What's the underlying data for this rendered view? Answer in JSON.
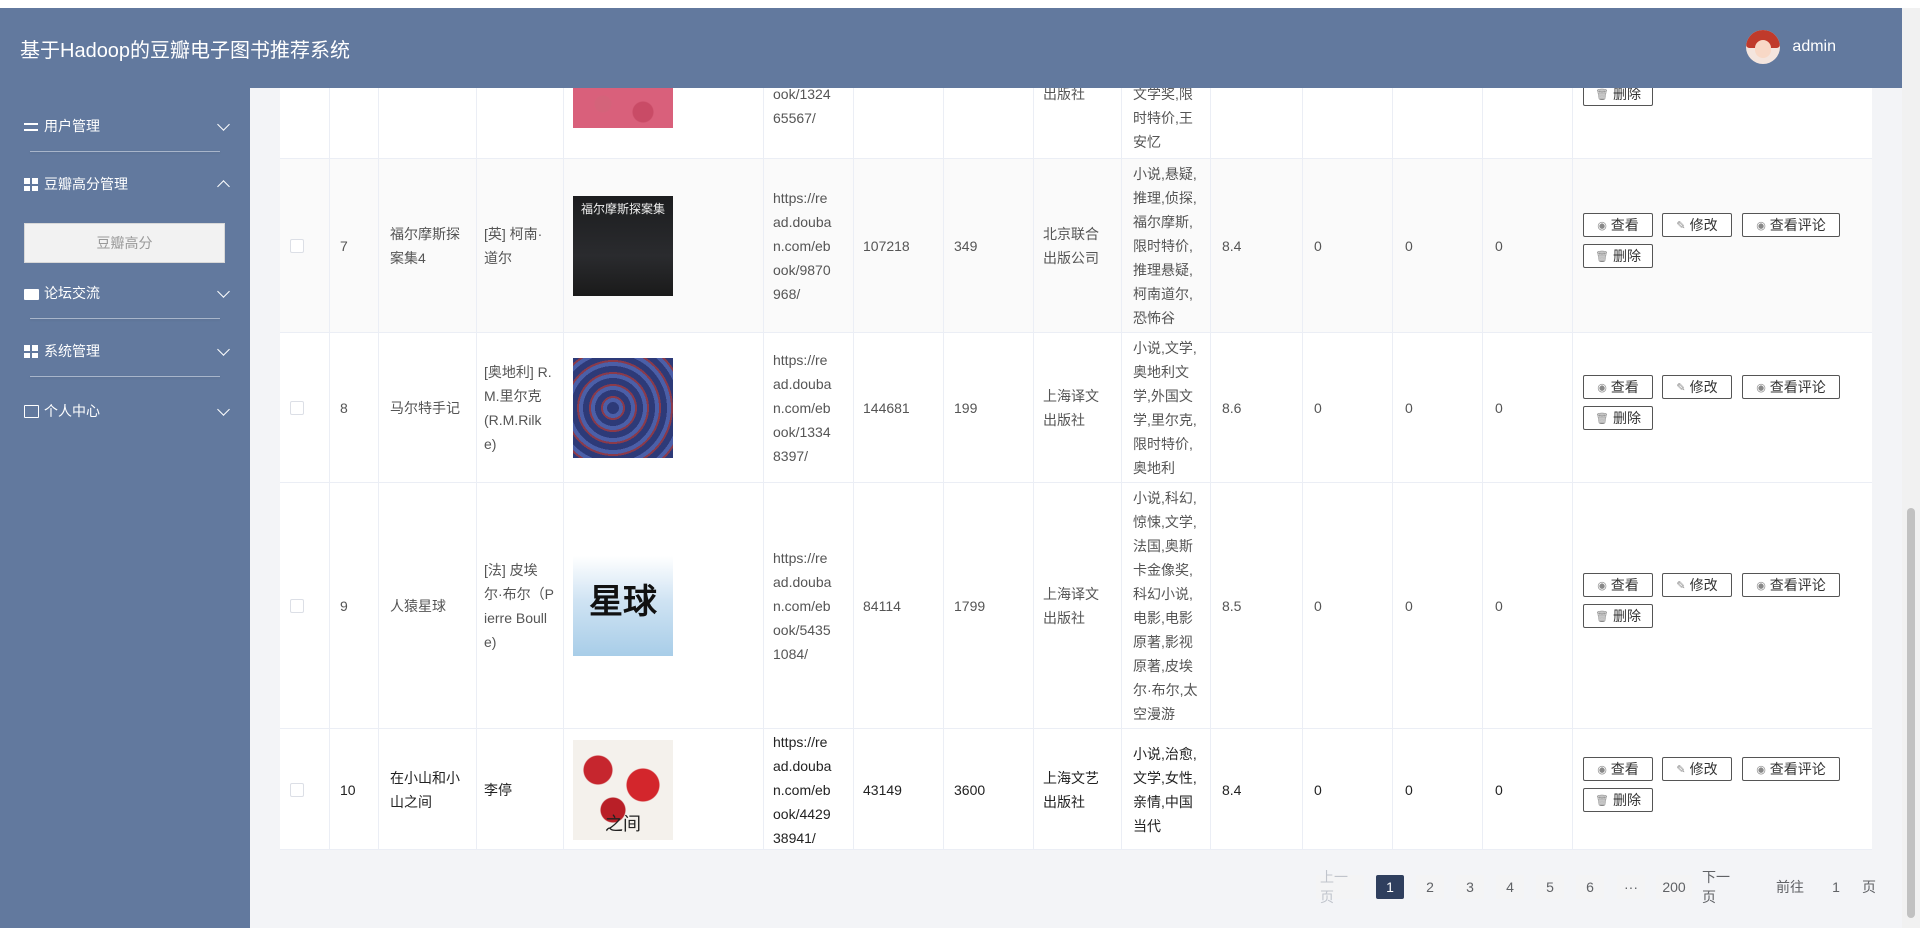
{
  "header": {
    "title": "基于Hadoop的豆瓣电子图书推荐系统",
    "username": "admin"
  },
  "sidebar": {
    "items": [
      {
        "label": "用户管理",
        "icon": "sliders-icon",
        "expanded": false
      },
      {
        "label": "豆瓣高分管理",
        "icon": "grid-icon",
        "expanded": true
      },
      {
        "label": "论坛交流",
        "icon": "briefcase-icon",
        "expanded": false
      },
      {
        "label": "系统管理",
        "icon": "grid-icon",
        "expanded": false
      },
      {
        "label": "个人中心",
        "icon": "card-icon",
        "expanded": false
      }
    ],
    "submenu_active": "豆瓣高分"
  },
  "partial_row": {
    "url_lines": [
      "ook/1324",
      "65567/"
    ],
    "publisher_lines": [
      "出版社"
    ],
    "tags_lines": [
      "文学奖,限",
      "时特价,王",
      "安忆"
    ],
    "delete_label": "删除"
  },
  "rows": [
    {
      "index": "7",
      "title_lines": [
        "福尔摩斯探",
        "案集4"
      ],
      "author_lines": [
        "[英] 柯南·",
        "道尔"
      ],
      "cover_text": "福尔摩斯探案集",
      "url_lines": [
        "https://re",
        "ad.douba",
        "n.com/eb",
        "ook/9870",
        "968/"
      ],
      "ratings": "107218",
      "pages": "349",
      "publisher_lines": [
        "北京联合",
        "出版公司"
      ],
      "tags_lines": [
        "小说,悬疑,",
        "推理,侦探,",
        "福尔摩斯,",
        "限时特价,",
        "推理悬疑,",
        "柯南道尔,",
        "恐怖谷"
      ],
      "score": "8.4",
      "c1": "0",
      "c2": "0",
      "c3": "0"
    },
    {
      "index": "8",
      "title_lines": [
        "马尔特手记"
      ],
      "author_lines": [
        "[奥地利] R.",
        "M.里尔克",
        "(R.M.Rilk",
        "e)"
      ],
      "cover_text": "",
      "url_lines": [
        "https://re",
        "ad.douba",
        "n.com/eb",
        "ook/1334",
        "8397/"
      ],
      "ratings": "144681",
      "pages": "199",
      "publisher_lines": [
        "上海译文",
        "出版社"
      ],
      "tags_lines": [
        "小说,文学,",
        "奥地利文",
        "学,外国文",
        "学,里尔克,",
        "限时特价,",
        "奥地利"
      ],
      "score": "8.6",
      "c1": "0",
      "c2": "0",
      "c3": "0"
    },
    {
      "index": "9",
      "title_lines": [
        "人猿星球"
      ],
      "author_lines": [
        "[法] 皮埃",
        "尔·布尔（P",
        "ierre Boull",
        "e)"
      ],
      "cover_text": "星球",
      "url_lines": [
        "https://re",
        "ad.douba",
        "n.com/eb",
        "ook/5435",
        "1084/"
      ],
      "ratings": "84114",
      "pages": "1799",
      "publisher_lines": [
        "上海译文",
        "出版社"
      ],
      "tags_lines": [
        "小说,科幻,",
        "惊悚,文学,",
        "法国,奥斯",
        "卡金像奖,",
        "科幻小说,",
        "电影,电影",
        "原著,影视",
        "原著,皮埃",
        "尔·布尔,太",
        "空漫游"
      ],
      "score": "8.5",
      "c1": "0",
      "c2": "0",
      "c3": "0"
    },
    {
      "index": "10",
      "title_lines": [
        "在小山和小",
        "山之间"
      ],
      "author_lines": [
        "李停"
      ],
      "cover_text": "之间",
      "url_lines": [
        "https://re",
        "ad.douba",
        "n.com/eb",
        "ook/4429",
        "38941/"
      ],
      "ratings": "43149",
      "pages": "3600",
      "publisher_lines": [
        "上海文艺",
        "出版社"
      ],
      "tags_lines": [
        "小说,治愈,",
        "文学,女性,",
        "亲情,中国",
        "当代"
      ],
      "score": "8.4",
      "c1": "0",
      "c2": "0",
      "c3": "0"
    }
  ],
  "actions": {
    "view": "查看",
    "edit": "修改",
    "view_comments": "查看评论",
    "delete": "删除"
  },
  "pagination": {
    "prev": "上一页",
    "pages": [
      "1",
      "2",
      "3",
      "4",
      "5",
      "6"
    ],
    "ellipsis": "···",
    "last": "200",
    "next": "下一页",
    "goto_prefix": "前往",
    "goto_value": "1",
    "goto_suffix": "页"
  },
  "colors": {
    "header_bg": "#62799e",
    "sidebar_bg": "#62799e",
    "pager_active": "#2f3f5e"
  }
}
